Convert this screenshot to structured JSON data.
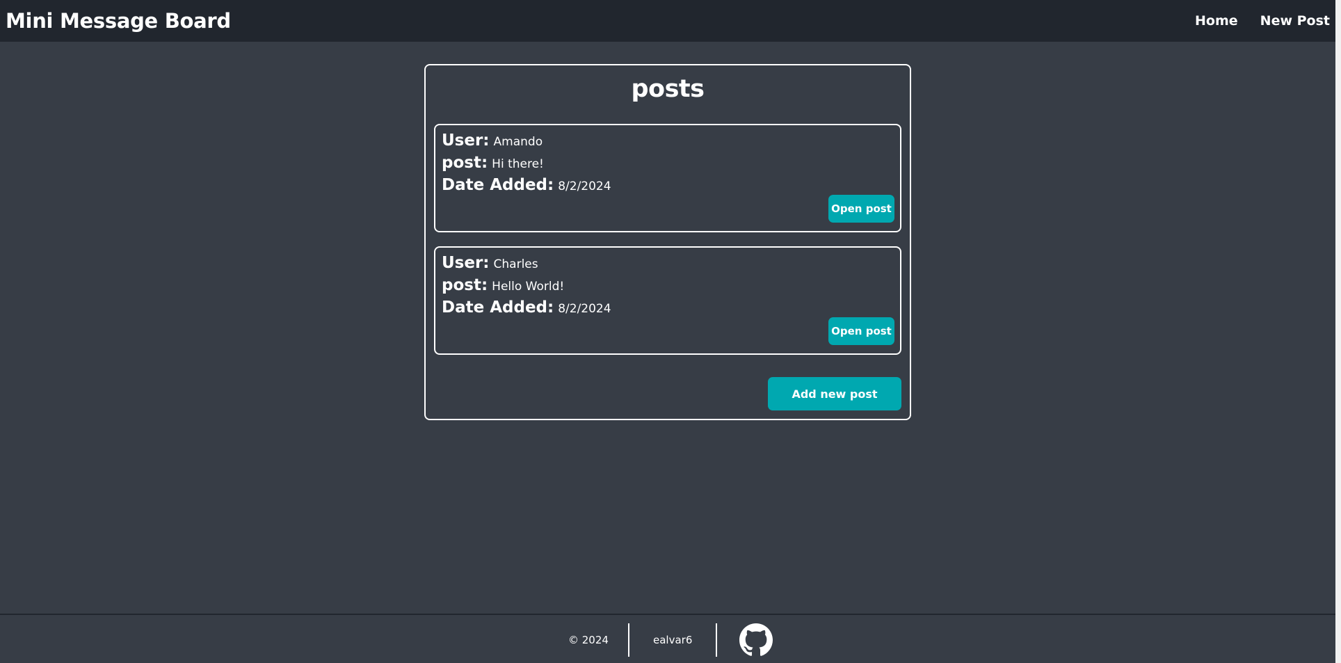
{
  "header": {
    "site_title": "Mini Message Board",
    "nav": [
      {
        "label": "Home"
      },
      {
        "label": "New Post"
      }
    ]
  },
  "main": {
    "title": "posts",
    "labels": {
      "user": "User:",
      "post": "post:",
      "date": "Date Added:"
    },
    "posts": [
      {
        "user": "Amando",
        "post": "Hi there!",
        "date": "8/2/2024",
        "button_label": "Open post"
      },
      {
        "user": "Charles",
        "post": "Hello World!",
        "date": "8/2/2024",
        "button_label": "Open post"
      }
    ],
    "add_button_label": "Add new post"
  },
  "footer": {
    "copyright": "© 2024",
    "username": "ealvar6",
    "icon": "github-icon"
  },
  "colors": {
    "page_bg": "#373d46",
    "header_bg": "#21262e",
    "accent": "#00a8b0",
    "text": "#ffffff"
  }
}
